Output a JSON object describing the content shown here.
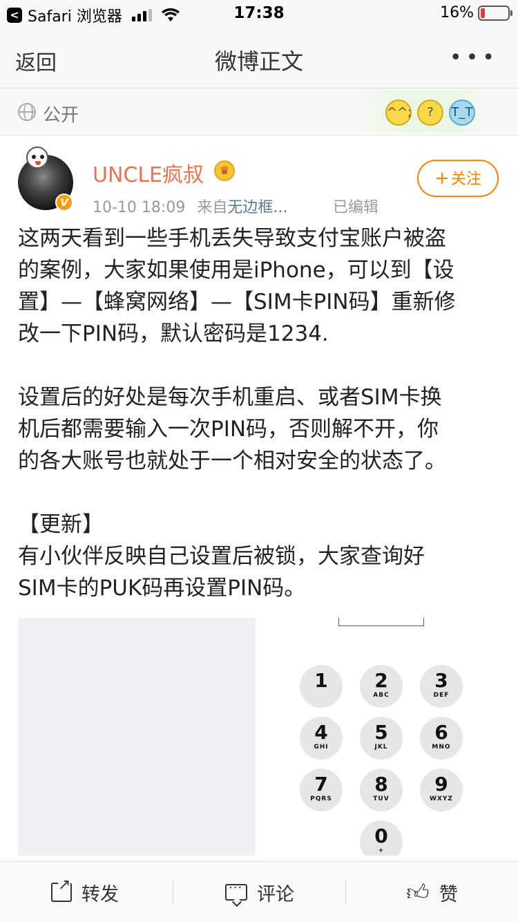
{
  "status_bar": {
    "back_app": "Safari 浏览器",
    "time": "17:38",
    "battery_percent": "16%",
    "battery_level": 0.16,
    "battery_color": "#e53935"
  },
  "nav": {
    "back_label": "返回",
    "title": "微博正文",
    "more_icon": "more-dots-icon"
  },
  "visibility": {
    "label": "公开",
    "icon": "globe-icon",
    "emojis": [
      "sweat-smile-emoji",
      "confused-emoji",
      "crying-emoji"
    ]
  },
  "author": {
    "name": "UNCLE疯叔",
    "time": "10-10 18:09",
    "source_prefix": "来自",
    "source": "无边框...",
    "edited": "已编辑",
    "follow_label": "关注",
    "name_color": "#eb7350",
    "follow_color": "#ff8200"
  },
  "post": {
    "paragraphs": [
      "这两天看到一些手机丢失导致支付宝账户被盗\n的案例，大家如果使用是iPhone，可以到【设\n置】—【蜂窝网络】—【SIM卡PIN码】重新修\n改一下PIN码，默认密码是1234.",
      "设置后的好处是每次手机重启、或者SIM卡换\n机后都需要输入一次PIN码，否则解不开，你\n的各大账号也就处于一个相对安全的状态了。",
      "【更新】\n有小伙伴反映自己设置后被锁，大家查询好\nSIM卡的PUK码再设置PIN码。"
    ]
  },
  "keypad": {
    "keys": [
      {
        "num": "1",
        "sub": ""
      },
      {
        "num": "2",
        "sub": "ABC"
      },
      {
        "num": "3",
        "sub": "DEF"
      },
      {
        "num": "4",
        "sub": "GHI"
      },
      {
        "num": "5",
        "sub": "JKL"
      },
      {
        "num": "6",
        "sub": "MNO"
      },
      {
        "num": "7",
        "sub": "PQRS"
      },
      {
        "num": "8",
        "sub": "TUV"
      },
      {
        "num": "9",
        "sub": "WXYZ"
      },
      {
        "num": "0",
        "sub": "+"
      }
    ]
  },
  "actions": {
    "forward": "转发",
    "comment": "评论",
    "like": "赞"
  }
}
